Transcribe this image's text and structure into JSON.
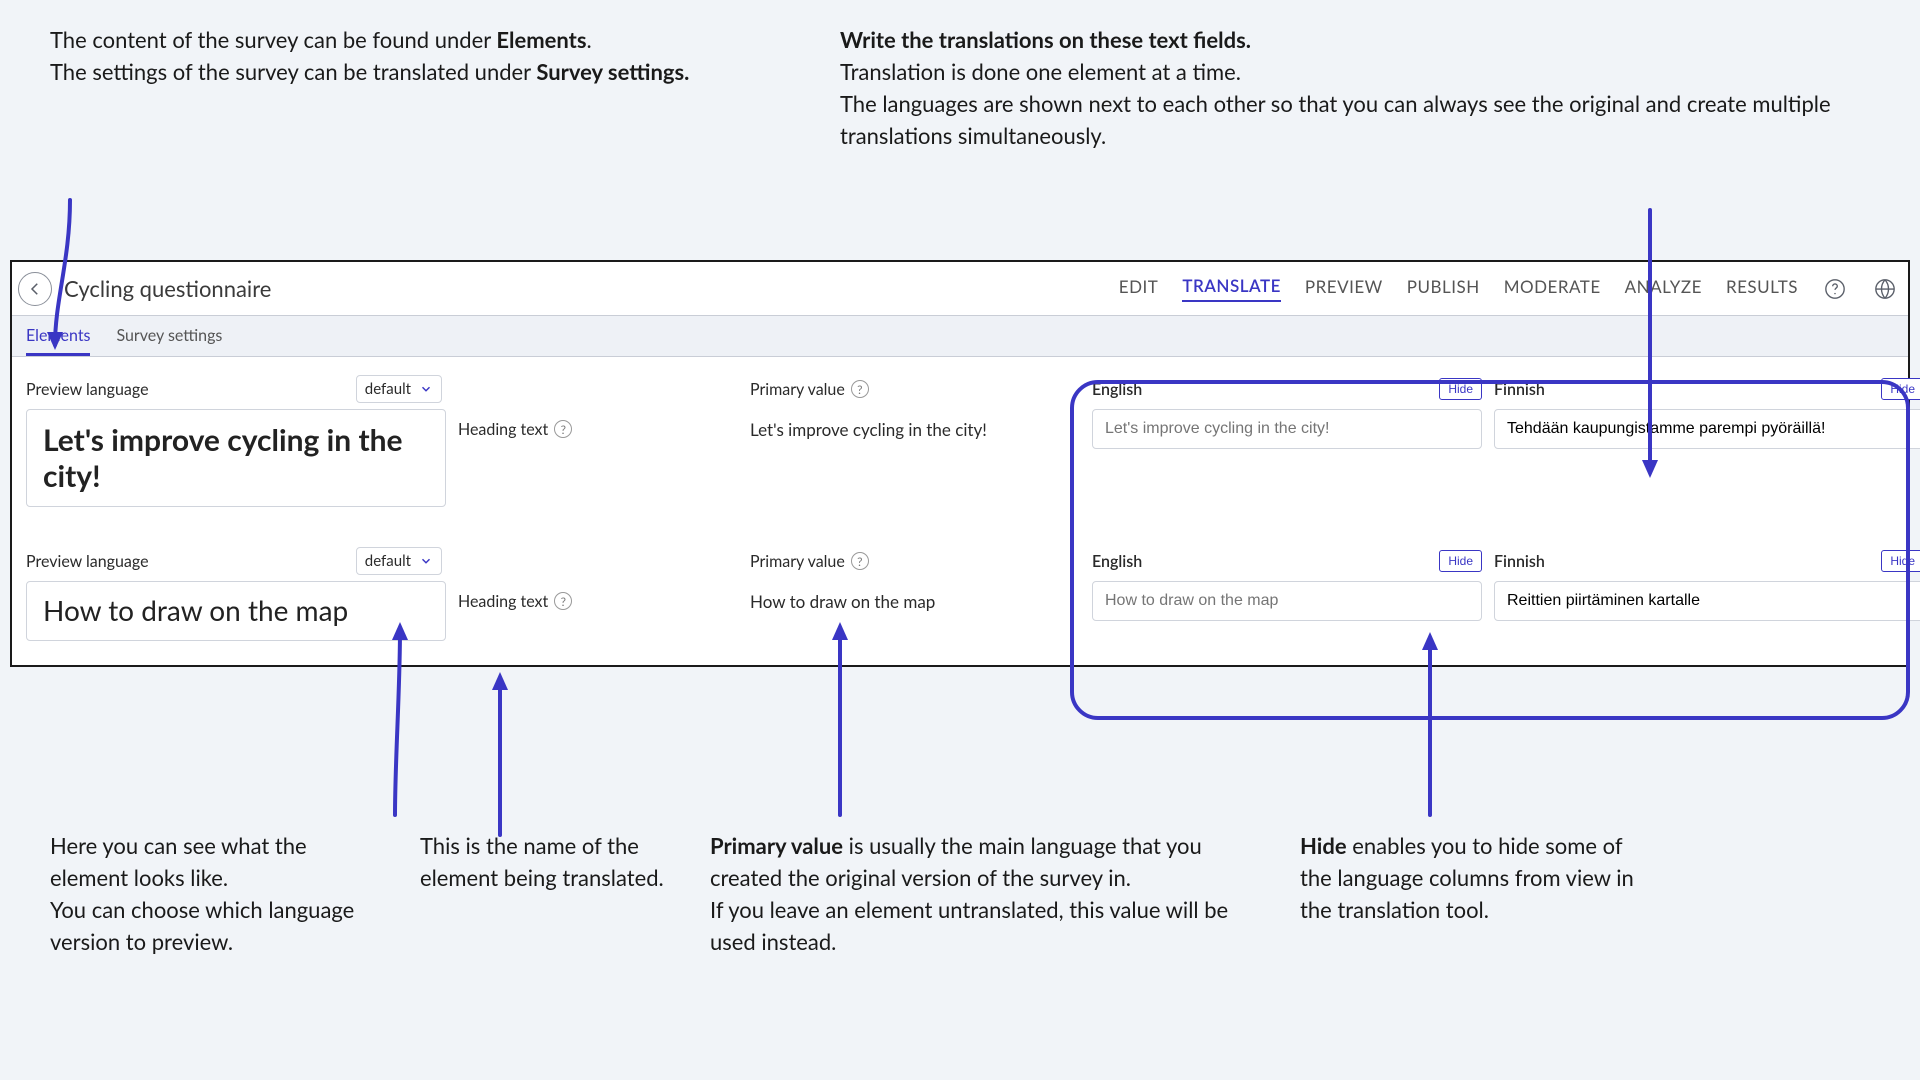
{
  "anno": {
    "top_left_1": "The content of the survey can be found under ",
    "top_left_bold_1": "Elements",
    "top_left_2": ". ",
    "top_left_3": "The settings of the survey can be translated under ",
    "top_left_bold_2": "Survey settings.",
    "top_right_lead": "Write the translations on these text fields.",
    "top_right_2": "Translation is done one element at a time.",
    "top_right_3": "The languages are shown next to each other so that you can always see the original and create multiple translations simultaneously.",
    "bottom_1_a": "Here you can see what the element looks like.",
    "bottom_1_b": "You can choose which language version to preview.",
    "bottom_2": "This is the name of the element being translated.",
    "bottom_3_bold": "Primary value",
    "bottom_3_rest": " is usually the main language that you created the original version of the survey in.",
    "bottom_3_b": "If you leave an element untranslated, this value will be used instead.",
    "bottom_4_bold": "Hide",
    "bottom_4_rest": " enables you to hide some of the language columns from view in the translation tool."
  },
  "app": {
    "title": "Cycling questionnaire",
    "nav": {
      "edit": "EDIT",
      "translate": "TRANSLATE",
      "preview": "PREVIEW",
      "publish": "PUBLISH",
      "moderate": "MODERATE",
      "analyze": "ANALYZE",
      "results": "RESULTS"
    },
    "subtabs": {
      "elements": "Elements",
      "survey_settings": "Survey settings"
    },
    "labels": {
      "preview_language": "Preview language",
      "default": "default",
      "heading_text": "Heading text",
      "primary_value": "Primary value",
      "english": "English",
      "finnish": "Finnish",
      "hide": "Hide",
      "help": "?"
    },
    "rows": [
      {
        "preview_heading": "Let's improve cycling in the city!",
        "primary_value": "Let's improve cycling in the city!",
        "english_placeholder": "Let's improve cycling in the city!",
        "finnish_value": "Tehdään kaupungistamme parempi pyöräillä!"
      },
      {
        "preview_heading": "How to draw on the map",
        "primary_value": "How to draw on the map",
        "english_placeholder": "How to draw on the map",
        "finnish_value": "Reittien piirtäminen kartalle"
      }
    ]
  }
}
